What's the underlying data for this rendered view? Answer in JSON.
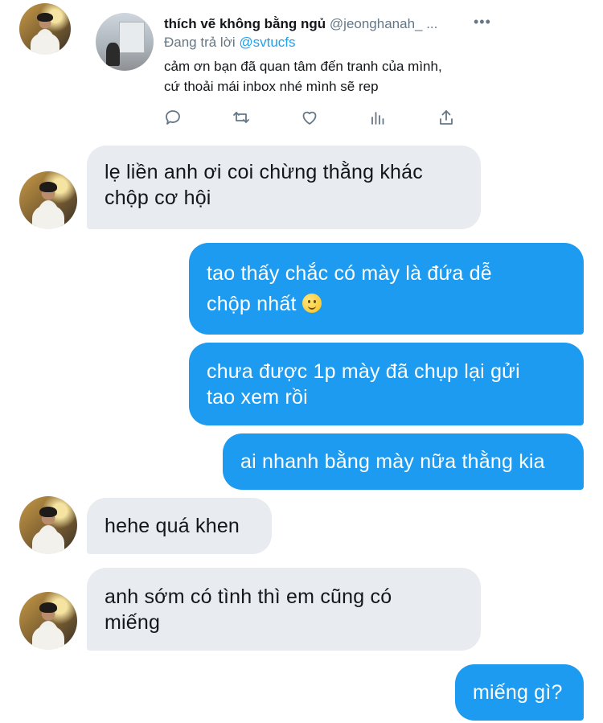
{
  "tweet": {
    "display_name": "thích vẽ không bằng ngủ",
    "handle": "@jeonghanah_ ...",
    "more_label": "•••",
    "reply_prefix": "Đang trả lời",
    "reply_mention": "@svtucfs",
    "text_line1": "cảm ơn bạn đã quan tâm đến tranh của mình,",
    "text_line2": "cứ thoải mái inbox nhé mình sẽ rep",
    "actions": [
      "reply-icon",
      "retweet-icon",
      "like-icon",
      "analytics-icon",
      "share-icon"
    ]
  },
  "messages": [
    {
      "side": "in",
      "lines": [
        "lẹ liền anh ơi coi chừng thằng khác",
        "chộp cơ hội"
      ]
    },
    {
      "side": "out",
      "lines": [
        "tao thấy chắc có mày là đứa dễ",
        "chộp nhất"
      ],
      "emoji": "slightly-smiling-face-icon"
    },
    {
      "side": "out",
      "lines": [
        "chưa được 1p mày đã chụp lại gửi",
        "tao xem rồi"
      ]
    },
    {
      "side": "out",
      "lines": [
        "ai nhanh bằng mày nữa thằng kia"
      ]
    },
    {
      "side": "in",
      "lines": [
        "hehe quá khen"
      ]
    },
    {
      "side": "in",
      "lines": [
        "anh sớm có tình thì em cũng có",
        "miếng"
      ]
    },
    {
      "side": "out",
      "lines": [
        "miếng gì?"
      ]
    }
  ],
  "colors": {
    "incoming_bubble": "#e8ebef",
    "outgoing_bubble": "#1d9bf0",
    "mention": "#1da1f2",
    "muted_text": "#657786"
  }
}
